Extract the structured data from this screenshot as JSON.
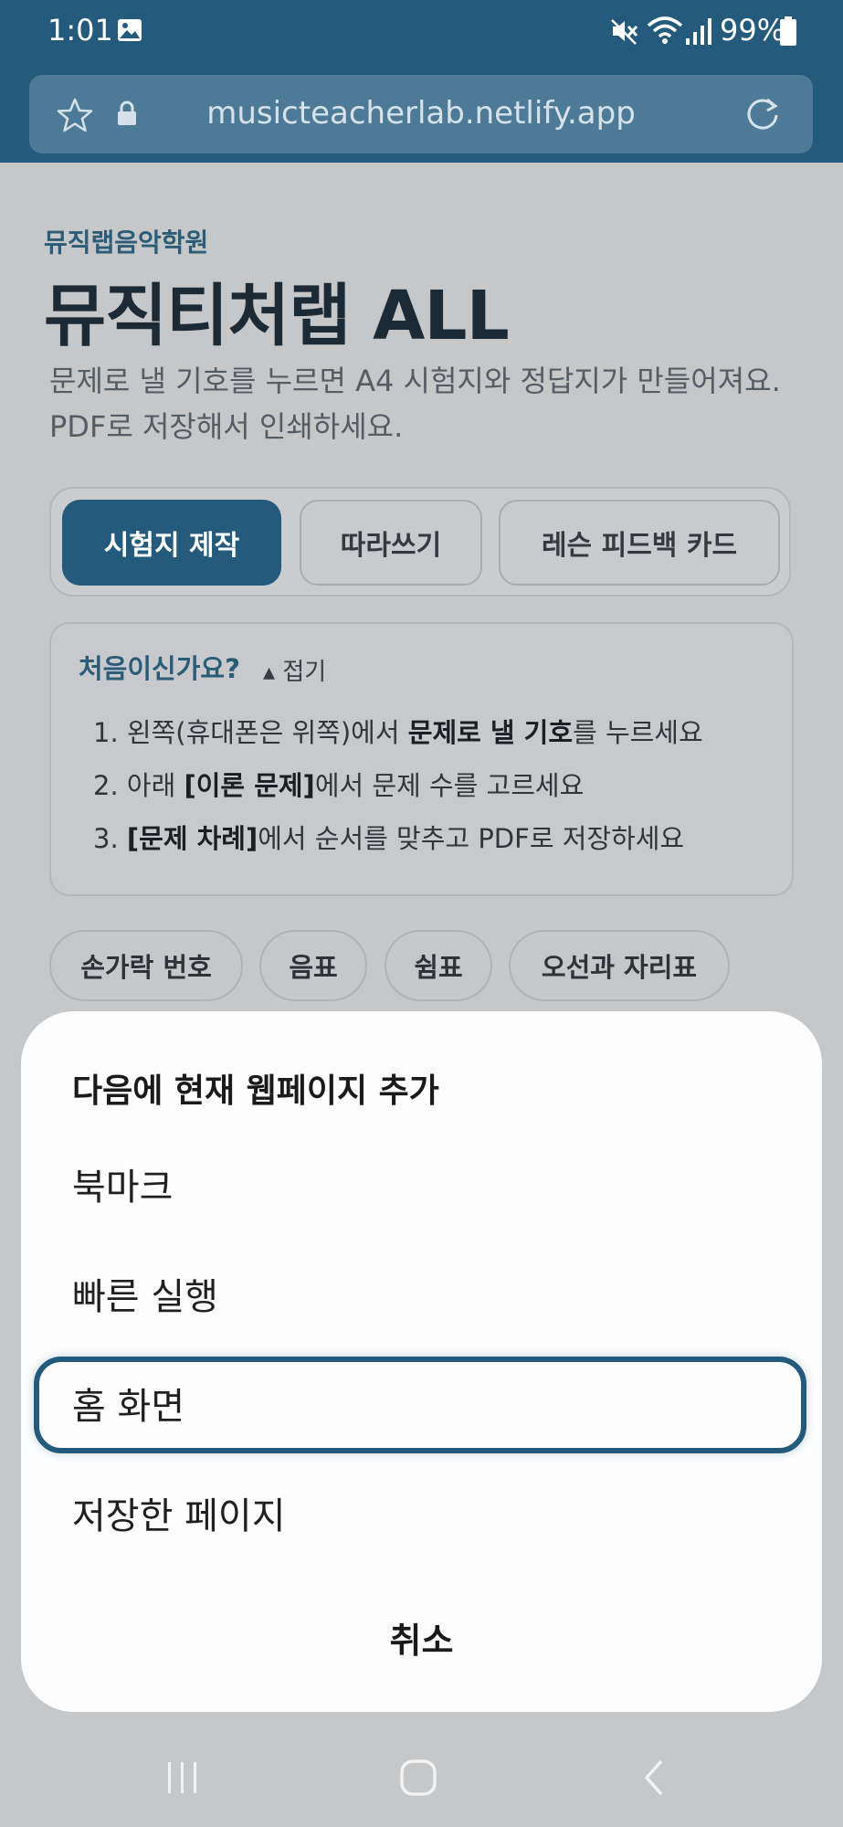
{
  "status_bar": {
    "time": "1:01",
    "battery": "99%"
  },
  "browser": {
    "url": "musicteacherlab.netlify.app"
  },
  "page": {
    "academy": "뮤직랩음악학원",
    "title": "뮤직티처랩 ALL",
    "description": "문제로 낼 기호를 누르면 A4 시험지와 정답지가 만들어져요. PDF로 저장해서 인쇄하세요.",
    "tabs": [
      {
        "label": "시험지 제작",
        "active": true
      },
      {
        "label": "따라쓰기",
        "active": false
      },
      {
        "label": "레슨 피드백 카드",
        "active": false
      }
    ],
    "guide": {
      "title": "처음이신가요?",
      "toggle": "▴ 접기",
      "steps": [
        {
          "num": "1.",
          "pre": "왼쪽(휴대폰은 위쪽)에서 ",
          "bold": "문제로 낼 기호",
          "post": "를 누르세요"
        },
        {
          "num": "2.",
          "pre": "아래 ",
          "bold": "[이론 문제]",
          "post": "에서 문제 수를 고르세요"
        },
        {
          "num": "3.",
          "pre": "",
          "bold": "[문제 차례]",
          "post": "에서 순서를 맞추고 PDF로 저장하세요"
        }
      ]
    },
    "chips": [
      "손가락 번호",
      "음표",
      "쉼표",
      "오선과 자리표"
    ]
  },
  "sheet": {
    "title": "다음에 현재 웹페이지 추가",
    "items": [
      "북마크",
      "빠른 실행",
      "홈 화면",
      "저장한 페이지"
    ],
    "selected_item": "홈 화면",
    "cancel": "취소"
  },
  "colors": {
    "primary": "#245a7b",
    "backdrop": "#c6c7c9",
    "sheet": "#fdfdfd"
  },
  "icons": [
    "gallery-icon",
    "mute-icon",
    "wifi-icon",
    "signal-icon",
    "battery-icon",
    "star-icon",
    "lock-icon",
    "reload-icon",
    "recent-apps-icon",
    "home-icon",
    "back-icon"
  ]
}
